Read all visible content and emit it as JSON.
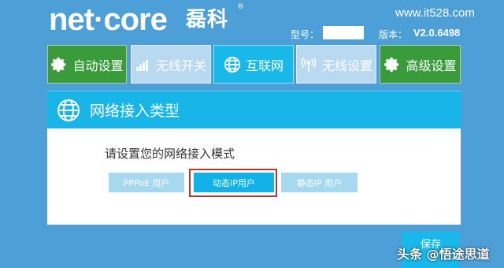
{
  "header": {
    "brand_en": "net·core",
    "brand_cn": "磊科",
    "registered_mark": "®",
    "site": "www.it528.com",
    "model_label": "型号：",
    "model_value": "",
    "version_label": "版本：",
    "version_value": "V2.0.6498"
  },
  "nav": {
    "tabs": [
      {
        "label": "自动设置",
        "icon": "gear-icon",
        "style": "green"
      },
      {
        "label": "无线开关",
        "icon": "signal-bars-icon",
        "style": "light"
      },
      {
        "label": "互联网",
        "icon": "globe-icon",
        "style": "blue"
      },
      {
        "label": "无线设置",
        "icon": "wireless-antenna-icon",
        "style": "light"
      },
      {
        "label": "高级设置",
        "icon": "gear-icon",
        "style": "green"
      }
    ]
  },
  "panel": {
    "title": "网络接入类型",
    "prompt": "请设置您的网络接入模式",
    "options": [
      {
        "label": "PPPoE 用户",
        "selected": false
      },
      {
        "label": "动态IP用户",
        "selected": true
      },
      {
        "label": "静态IP 用户",
        "selected": false
      }
    ],
    "save_label": "保存"
  },
  "watermark": "头条 @悟途思道",
  "colors": {
    "background": "#4d9fd8",
    "accent_blue": "#18b8ea",
    "green": "#3a9b3a",
    "light_blue": "#b8d9f0",
    "highlight_red": "#b5342b"
  }
}
